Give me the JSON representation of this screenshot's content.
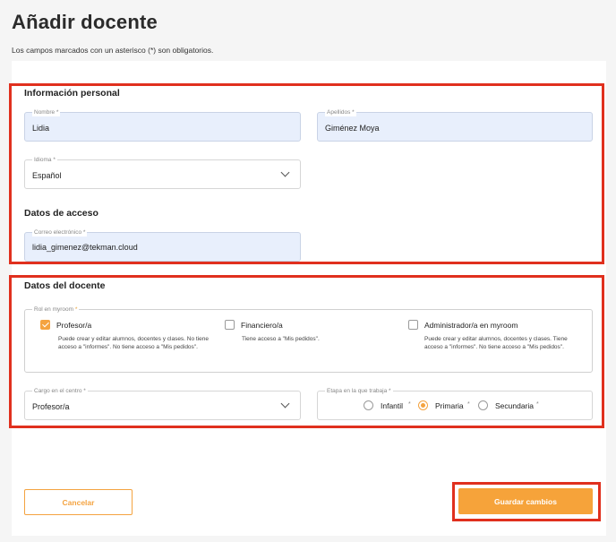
{
  "page": {
    "title": "Añadir docente",
    "subtitle": "Los campos marcados con un asterisco (*) son obligatorios."
  },
  "personal": {
    "title": "Información personal",
    "nombre": {
      "label": "Nombre *",
      "value": "Lidia"
    },
    "apellidos": {
      "label": "Apellidos *",
      "value": "Giménez Moya"
    },
    "idioma": {
      "label": "Idioma *",
      "value": "Español"
    }
  },
  "acceso": {
    "title": "Datos de acceso",
    "correo": {
      "label": "Correo electrónico *",
      "value": "lidia_gimenez@tekman.cloud"
    }
  },
  "docente": {
    "title": "Datos del docente",
    "rol": {
      "label": "Rol en myroom",
      "star": "*",
      "options": [
        {
          "label": "Profesor/a",
          "checked": true,
          "desc": "Puede crear y editar alumnos, docentes y clases. No tiene acceso a \"informes\". No tiene acceso a \"Mis pedidos\"."
        },
        {
          "label": "Financiero/a",
          "checked": false,
          "desc": "Tiene acceso a \"Mis pedidos\"."
        },
        {
          "label": "Administrador/a en myroom",
          "checked": false,
          "desc": "Puede crear y editar alumnos, docentes y clases. Tiene acceso a \"informes\". No tiene acceso a \"Mis pedidos\"."
        }
      ]
    },
    "cargo": {
      "label": "Cargo en el centro *",
      "value": "Profesor/a"
    },
    "etapa": {
      "label": "Etapa en la que trabaja *",
      "options": [
        {
          "label": "Infantil",
          "star": "*",
          "checked": false
        },
        {
          "label": "Primaria",
          "star": "*",
          "checked": true
        },
        {
          "label": "Secundaria",
          "star": "*",
          "checked": false
        }
      ]
    }
  },
  "actions": {
    "cancel": "Cancelar",
    "save": "Guardar cambios"
  },
  "colors": {
    "accent": "#f6a33a",
    "highlight": "#e0301e",
    "filled_field": "#e8effc"
  }
}
